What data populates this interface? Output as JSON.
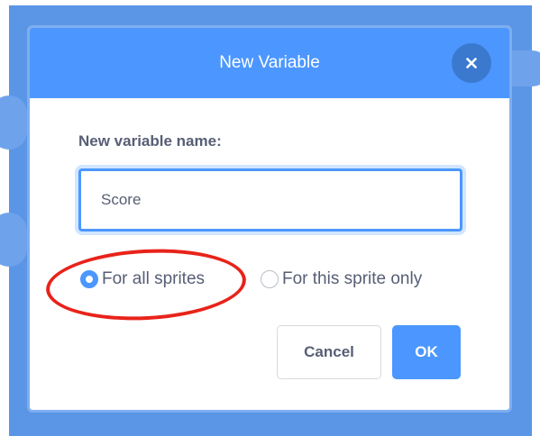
{
  "dialog": {
    "title": "New Variable",
    "close_icon": "close-icon",
    "field_label": "New variable name:",
    "input_value": "Score",
    "scope_options": [
      {
        "label": "For all sprites",
        "selected": true
      },
      {
        "label": "For this sprite only",
        "selected": false
      }
    ],
    "cancel_label": "Cancel",
    "ok_label": "OK"
  },
  "colors": {
    "accent": "#4c97ff",
    "text": "#575e75",
    "annotation": "#e8231a"
  }
}
